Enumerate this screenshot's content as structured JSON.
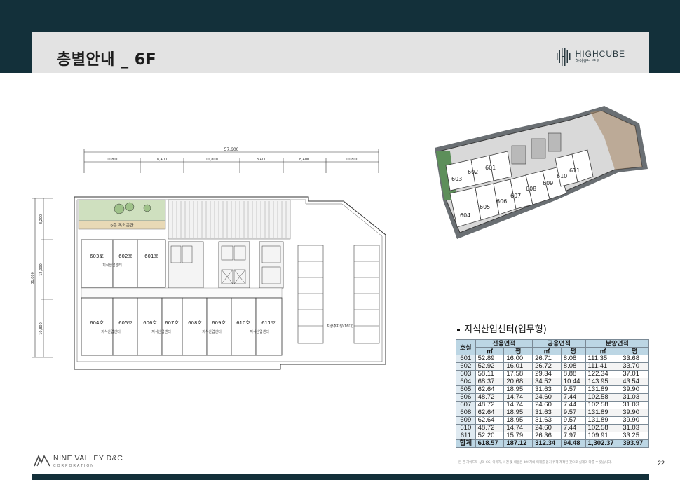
{
  "header": {
    "title": "층별안내 _ 6F",
    "logo_text": "HIGHCUBE",
    "logo_sub": "하이큐브 구로"
  },
  "floor_plan": {
    "total_dim": "57,600",
    "column_dims": [
      "10,800",
      "8,400",
      "10,800",
      "8,400",
      "8,400",
      "10,800"
    ],
    "side_total": "31,000",
    "side_dims": [
      "8,200",
      "12,000",
      "10,800"
    ],
    "outdoor_label": "6층 옥외공간",
    "rooms_top": [
      "603호",
      "602호",
      "601호"
    ],
    "rooms_bottom": [
      "604호",
      "605호",
      "606호",
      "607호",
      "608호",
      "609호",
      "610호",
      "611호"
    ],
    "use_label": "지식산업센터",
    "parking_label": "지상주차장(16대)"
  },
  "render_3d": {
    "labels": [
      "603",
      "602",
      "601",
      "604",
      "605",
      "606",
      "607",
      "608",
      "609",
      "610",
      "611"
    ]
  },
  "table": {
    "section_title": "지식산업센터(업무형)",
    "headers": {
      "room": "호실",
      "exclusive": "전용면적",
      "common": "공용면적",
      "sale": "분양면적",
      "sqm": "㎡",
      "pyeong": "평"
    },
    "rows": [
      [
        "601",
        "52.89",
        "16.00",
        "26.71",
        "8.08",
        "111.35",
        "33.68"
      ],
      [
        "602",
        "52.92",
        "16.01",
        "26.72",
        "8.08",
        "111.41",
        "33.70"
      ],
      [
        "603",
        "58.11",
        "17.58",
        "29.34",
        "8.88",
        "122.34",
        "37.01"
      ],
      [
        "604",
        "68.37",
        "20.68",
        "34.52",
        "10.44",
        "143.95",
        "43.54"
      ],
      [
        "605",
        "62.64",
        "18.95",
        "31.63",
        "9.57",
        "131.89",
        "39.90"
      ],
      [
        "606",
        "48.72",
        "14.74",
        "24.60",
        "7.44",
        "102.58",
        "31.03"
      ],
      [
        "607",
        "48.72",
        "14.74",
        "24.60",
        "7.44",
        "102.58",
        "31.03"
      ],
      [
        "608",
        "62.64",
        "18.95",
        "31.63",
        "9.57",
        "131.89",
        "39.90"
      ],
      [
        "609",
        "62.64",
        "18.95",
        "31.63",
        "9.57",
        "131.89",
        "39.90"
      ],
      [
        "610",
        "48.72",
        "14.74",
        "24.60",
        "7.44",
        "102.58",
        "31.03"
      ],
      [
        "611",
        "52.20",
        "15.79",
        "26.36",
        "7.97",
        "109.91",
        "33.25"
      ]
    ],
    "total": [
      "합계",
      "618.57",
      "187.12",
      "312.34",
      "94.48",
      "1,302.37",
      "393.97"
    ]
  },
  "footer": {
    "company": "NINE VALLEY D&C",
    "company_sub": "CORPORATION",
    "disclaimer": "본 판 가이드북 상의 CG, 이미지, 사진 및 내용은 소비자의 이해를 돕기 위해 제작된 것으로 실제와 다를 수 있습니다.",
    "page": "22"
  }
}
